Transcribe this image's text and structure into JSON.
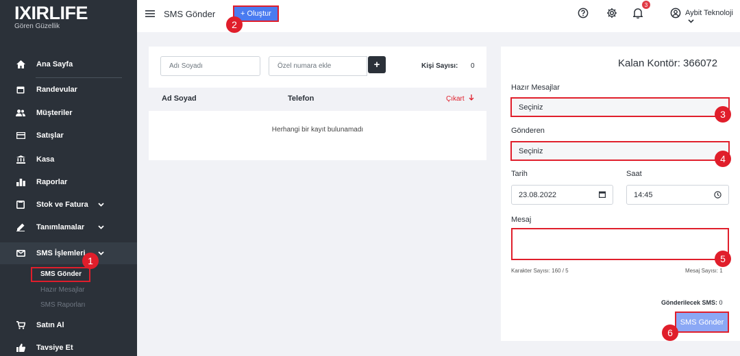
{
  "brand": {
    "title": "IXIRLIFE",
    "subtitle": "Gören Güzellik"
  },
  "sidebar": {
    "items": [
      {
        "label": "Ana Sayfa",
        "icon": "home-icon"
      },
      {
        "label": "Randevular",
        "icon": "calendar-icon"
      },
      {
        "label": "Müşteriler",
        "icon": "users-icon"
      },
      {
        "label": "Satışlar",
        "icon": "card-icon"
      },
      {
        "label": "Kasa",
        "icon": "bank-icon"
      },
      {
        "label": "Raporlar",
        "icon": "chart-icon"
      },
      {
        "label": "Stok ve Fatura",
        "icon": "box-icon"
      },
      {
        "label": "Tanımlamalar",
        "icon": "pen-icon"
      },
      {
        "label": "SMS İşlemleri",
        "icon": "mail-icon"
      },
      {
        "label": "Satın Al",
        "icon": "cart-icon"
      },
      {
        "label": "Tavsiye Et",
        "icon": "thumbs-up-icon"
      }
    ],
    "sms_sub": [
      "SMS Gönder",
      "Hazır Mesajlar",
      "SMS Raporları"
    ]
  },
  "topbar": {
    "title": "SMS Gönder",
    "create_label": "+ Oluştur",
    "notification_count": "3",
    "user": "Aybit Teknoloji"
  },
  "recipients": {
    "name_placeholder": "Adı Soyadı",
    "number_placeholder": "Özel numara ekle",
    "count_label": "Kişi Sayısı:",
    "count_value": "0",
    "col_name": "Ad Soyad",
    "col_phone": "Telefon",
    "col_remove": "Çıkart",
    "empty_text": "Herhangi bir kayıt bulunamadı"
  },
  "form": {
    "credit": "Kalan Kontör: 366072",
    "templates_label": "Hazır Mesajlar",
    "templates_value": "Seçiniz",
    "sender_label": "Gönderen",
    "sender_value": "Seçiniz",
    "date_label": "Tarih",
    "date_value": "23.08.2022",
    "time_label": "Saat",
    "time_value": "14:45",
    "message_label": "Mesaj",
    "char_count": "Karakter Sayısı: 160 / 5",
    "msg_count": "Mesaj Sayısı: 1",
    "to_send_label": "Gönderilecek SMS:",
    "to_send_value": "0",
    "send_label": "SMS Gönder"
  },
  "markers": [
    "1",
    "2",
    "3",
    "4",
    "5",
    "6"
  ],
  "colors": {
    "accent": "#4a7bf0",
    "highlight": "#e01e2b",
    "sidebar": "#2b3139"
  }
}
